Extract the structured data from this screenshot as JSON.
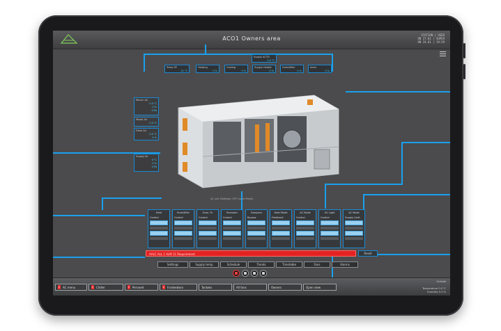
{
  "window": {
    "title": "ACO1 Owners area"
  },
  "status": {
    "line1": "STATION | USER",
    "line2": "ON 27.01 | SUPER",
    "line3": "ON 24.01 | 19:59"
  },
  "sensors": {
    "temp_sp": {
      "label": "Temp SP",
      "value": "21 ℃"
    },
    "heating": {
      "label": "Heating",
      "value": "0 %"
    },
    "cooling": {
      "label": "Cooling",
      "value": "0 %"
    },
    "supply_heater": {
      "label": "Supply Heater",
      "value": "0 %"
    },
    "supply_actual": {
      "label": "Supply ACTD",
      "value": "0.0 ℃"
    },
    "humidifier": {
      "label": "Humidifier",
      "value": "0 %"
    },
    "actor": {
      "label": "Actor",
      "value": "0 %"
    },
    "return_air": {
      "label": "Return Air",
      "rows": [
        "0.0 ℃",
        "0 %",
        "0 Pa"
      ]
    },
    "mixed_air": {
      "label": "Mixed Air",
      "rows": [
        "0.0 ℃"
      ]
    },
    "fresh_air": {
      "label": "Fresh Air",
      "rows": [
        "0.0 ℃",
        "0 %"
      ]
    },
    "supply_air": {
      "label": "Supply Air",
      "rows": [
        "0 ℃",
        "0 %",
        "0 Pa",
        "0 RPM"
      ]
    }
  },
  "unit_caption": "AC unit Gateway: OFF (Local Panel)",
  "modules": [
    {
      "title": "Heat",
      "sub": "Control"
    },
    {
      "title": "Humidifier",
      "sub": "Control"
    },
    {
      "title": "Econ. Pc",
      "sub": "Control"
    },
    {
      "title": "Promoter",
      "sub": "Control"
    },
    {
      "title": "Dampers",
      "sub": "Bypass"
    },
    {
      "title": "Heat Mode",
      "sub": "Feedback"
    },
    {
      "title": "AC Mode",
      "sub": "Control"
    },
    {
      "title": "UV Light",
      "sub": "Control"
    },
    {
      "title": "AC Mode",
      "sub": "Supply Limit"
    }
  ],
  "alarm": {
    "text": "AALC   ALL  1  ALM    11 Requirement",
    "reset_label": "Reset"
  },
  "subnav": [
    "Settings",
    "Supply temp",
    "Schedule",
    "Trends",
    "Timetable",
    "Fans",
    "Alarms"
  ],
  "bottom_nav": [
    {
      "key": "E",
      "label": "AC menu"
    },
    {
      "key": "E",
      "label": "Chiller"
    },
    {
      "key": "E",
      "label": "Pervoed"
    },
    {
      "key": "E",
      "label": "Fordeebwin"
    },
    {
      "key": "",
      "label": "Tankelo"
    },
    {
      "key": "",
      "label": "All fans"
    },
    {
      "key": "",
      "label": "Owners"
    },
    {
      "key": "",
      "label": "Open view"
    }
  ],
  "clock": "Outside",
  "temperature": {
    "line1": "Temperature 0.0 ℃",
    "line2": "Humidity 0.0 %"
  },
  "colors": {
    "accent": "#1aa0ee",
    "alarm": "#e32222",
    "panel": "#4b4b4d"
  }
}
